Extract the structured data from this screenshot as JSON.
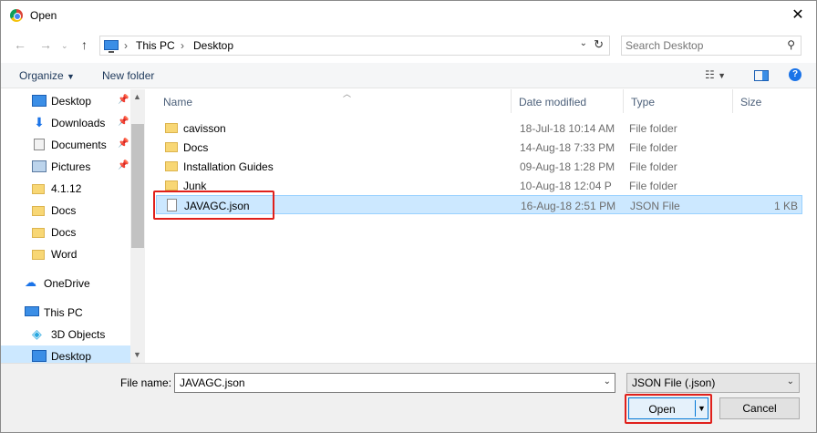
{
  "window": {
    "title": "Open"
  },
  "address": {
    "crumbs": [
      "This PC",
      "Desktop"
    ]
  },
  "search": {
    "placeholder": "Search Desktop"
  },
  "toolbar": {
    "organize": "Organize",
    "new_folder": "New folder"
  },
  "sidebar": {
    "items": [
      {
        "label": "Desktop",
        "icon": "desktop-icon",
        "pinned": true
      },
      {
        "label": "Downloads",
        "icon": "download-icon",
        "pinned": true
      },
      {
        "label": "Documents",
        "icon": "documents-icon",
        "pinned": true
      },
      {
        "label": "Pictures",
        "icon": "pictures-icon",
        "pinned": true
      },
      {
        "label": "4.1.12",
        "icon": "folder-icon"
      },
      {
        "label": "Docs",
        "icon": "folder-icon"
      },
      {
        "label": "Docs",
        "icon": "folder-icon"
      },
      {
        "label": "Word",
        "icon": "folder-icon"
      },
      {
        "label": "OneDrive",
        "icon": "onedrive-icon"
      },
      {
        "label": "This PC",
        "icon": "this-pc-icon"
      },
      {
        "label": "3D Objects",
        "icon": "3d-objects-icon"
      },
      {
        "label": "Desktop",
        "icon": "desktop-icon",
        "selected": true
      }
    ]
  },
  "columns": {
    "name": "Name",
    "date": "Date modified",
    "type": "Type",
    "size": "Size"
  },
  "files": [
    {
      "name": "cavisson",
      "date": "18-Jul-18 10:14 AM",
      "type": "File folder",
      "size": ""
    },
    {
      "name": "Docs",
      "date": "14-Aug-18 7:33 PM",
      "type": "File folder",
      "size": ""
    },
    {
      "name": "Installation Guides",
      "date": "09-Aug-18 1:28 PM",
      "type": "File folder",
      "size": ""
    },
    {
      "name": "Junk",
      "date": "10-Aug-18 12:04 P",
      "type": "File folder",
      "size": ""
    },
    {
      "name": "JAVAGC.json",
      "date": "16-Aug-18 2:51 PM",
      "type": "JSON File",
      "size": "1 KB",
      "selected": true
    }
  ],
  "footer": {
    "file_name_label": "File name:",
    "file_name_value": "JAVAGC.json",
    "file_type": "JSON File (.json)",
    "open_label": "Open",
    "cancel_label": "Cancel"
  },
  "colors": {
    "selection": "#cce8ff",
    "highlight_box": "#e0201b",
    "accent": "#0078d7"
  }
}
